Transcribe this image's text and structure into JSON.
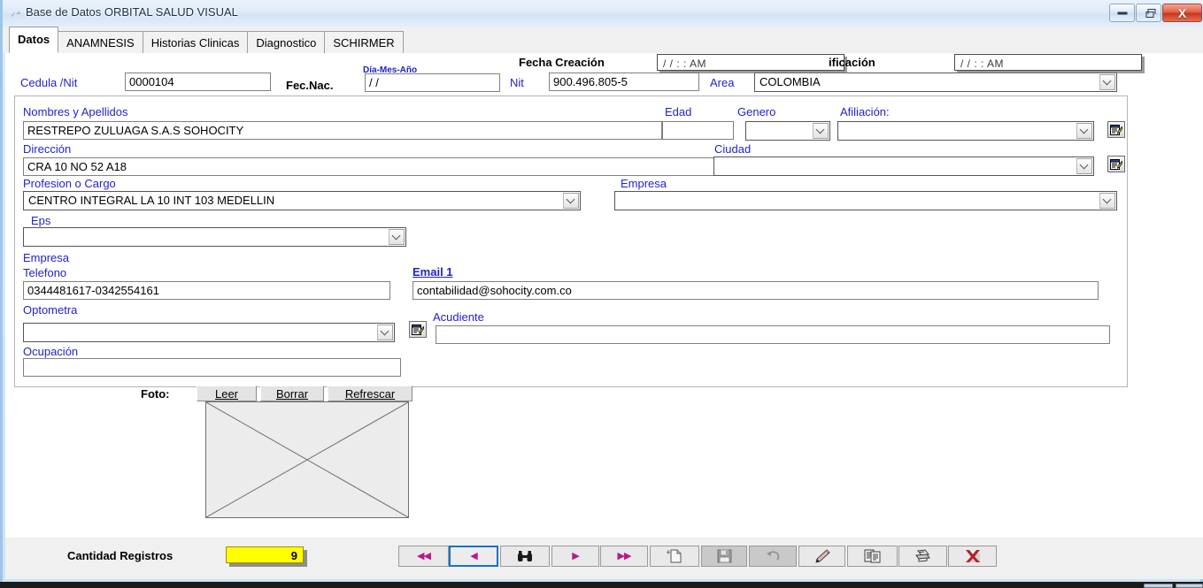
{
  "window": {
    "title": "Base de Datos ORBITAL SALUD VISUAL",
    "minimize_label": "Minimizar",
    "restore_label": "Restaurar",
    "close_label": "X"
  },
  "tabs": [
    {
      "label": "Datos",
      "active": true
    },
    {
      "label": "ANAMNESIS",
      "active": false
    },
    {
      "label": "Historias Clinicas",
      "active": false
    },
    {
      "label": "Diagnostico",
      "active": false
    },
    {
      "label": "SCHIRMER",
      "active": false
    }
  ],
  "header": {
    "fecha_creacion_label": "Fecha Creación",
    "fecha_creacion_value": "/ /    : :  AM",
    "fecha_modificacion_label": "ificación",
    "fecha_modificacion_value": "/ /    : :  AM"
  },
  "form": {
    "cedula_label": "Cedula /Nit",
    "cedula_value": "0000104",
    "fecnac_label": "Fec.Nac.",
    "fecnac_hint": "Día-Mes-Año",
    "fecnac_value": "/ /",
    "nit_label": "Nit",
    "nit_value": "900.496.805-5",
    "area_label": "Area",
    "area_value": "COLOMBIA",
    "nombres_label": "Nombres y Apellidos",
    "nombres_value": "RESTREPO ZULUAGA S.A.S SOHOCITY",
    "edad_label": "Edad",
    "edad_value": "",
    "genero_label": "Genero",
    "genero_value": "",
    "afiliacion_label": "Afiliación:",
    "afiliacion_value": "",
    "direccion_label": "Dirección",
    "direccion_value": "CRA 10 NO 52 A18",
    "ciudad_label": "Ciudad",
    "ciudad_value": "",
    "profesion_label": "Profesion o Cargo",
    "profesion_value": "CENTRO INTEGRAL LA 10 INT 103 MEDELLIN",
    "empresa_label": "Empresa",
    "empresa_value": "",
    "eps_label": "Eps",
    "eps_value": "",
    "empresa2_label": "Empresa",
    "telefono_label": "Telefono",
    "telefono_value": "0344481617-0342554161",
    "email_label": "Email 1",
    "email_value": "contabilidad@sohocity.com.co",
    "optometra_label": "Optometra",
    "optometra_value": "",
    "acudiente_label": "Acudiente",
    "acudiente_value": "",
    "ocupacion_label": "Ocupación",
    "ocupacion_value": ""
  },
  "foto": {
    "label": "Foto:",
    "leer": "Leer",
    "borrar": "Borrar",
    "refrescar": "Refrescar"
  },
  "footer": {
    "cantidad_label": "Cantidad Registros",
    "cantidad_value": "9",
    "buttons": [
      {
        "name": "first-record",
        "glyph": "◀◀",
        "state": "normal"
      },
      {
        "name": "previous-record",
        "glyph": "◀",
        "state": "selected"
      },
      {
        "name": "find-record",
        "glyph": "binoculars",
        "state": "normal"
      },
      {
        "name": "next-record",
        "glyph": "▶",
        "state": "normal"
      },
      {
        "name": "last-record",
        "glyph": "▶▶",
        "state": "normal"
      },
      {
        "name": "new-record",
        "glyph": "new-document",
        "state": "normal"
      },
      {
        "name": "save-record",
        "glyph": "floppy-disk",
        "state": "disabled"
      },
      {
        "name": "undo-record",
        "glyph": "undo-arrow",
        "state": "disabled"
      },
      {
        "name": "edit-record",
        "glyph": "pencil",
        "state": "normal"
      },
      {
        "name": "duplicate-record",
        "glyph": "copy-pages",
        "state": "normal"
      },
      {
        "name": "print-record",
        "glyph": "printer",
        "state": "normal"
      },
      {
        "name": "delete-record",
        "glyph": "red-x",
        "state": "normal"
      }
    ]
  },
  "colors": {
    "label_blue": "#2222cc",
    "accent_magenta": "#b8188c",
    "highlight_yellow": "#ffff00",
    "selection_blue": "#1a72c4"
  }
}
